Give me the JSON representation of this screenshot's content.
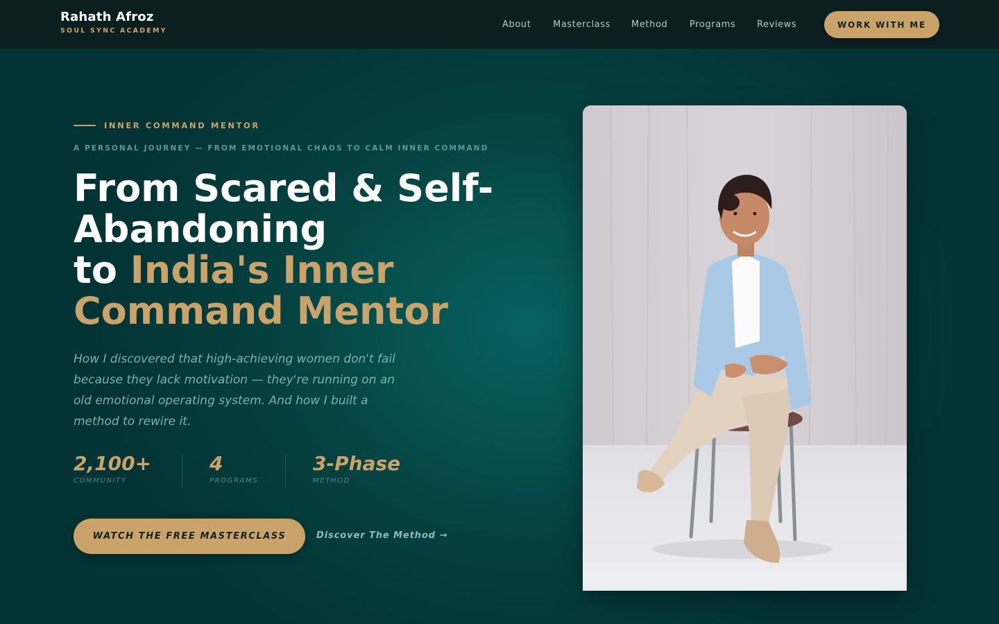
{
  "header": {
    "brand_name": "Rahath Afroz",
    "brand_subtitle": "SOUL SYNC ACADEMY",
    "nav": [
      "About",
      "Masterclass",
      "Method",
      "Programs",
      "Reviews"
    ],
    "cta_label": "WORK WITH ME"
  },
  "hero": {
    "eyebrow": "INNER COMMAND MENTOR",
    "kicker": "A PERSONAL JOURNEY — FROM EMOTIONAL CHAOS TO CALM INNER COMMAND",
    "headline_line1": "From Scared & Self-",
    "headline_line2": "Abandoning",
    "headline_line3_prefix": "to ",
    "headline_line3_gold": "India's Inner",
    "headline_line4_gold": "Command Mentor",
    "lede": "How I discovered that high-achieving women don't fail because they lack motivation — they're running on an old emotional operating system. And how I built a method to rewire it.",
    "stats": [
      {
        "value": "2,100+",
        "label": "COMMUNITY"
      },
      {
        "value": "4",
        "label": "PROGRAMS"
      },
      {
        "value": "3-Phase",
        "label": "METHOD"
      }
    ],
    "primary_cta": "WATCH THE FREE MASTERCLASS",
    "secondary_cta": "Discover The Method",
    "secondary_cta_icon": "arrow-right-icon"
  },
  "colors": {
    "accent_gold": "#c9a36a",
    "header_bg": "#0b1f21",
    "hero_bg": "#05403f",
    "muted_teal_text": "#7fb0ac"
  }
}
